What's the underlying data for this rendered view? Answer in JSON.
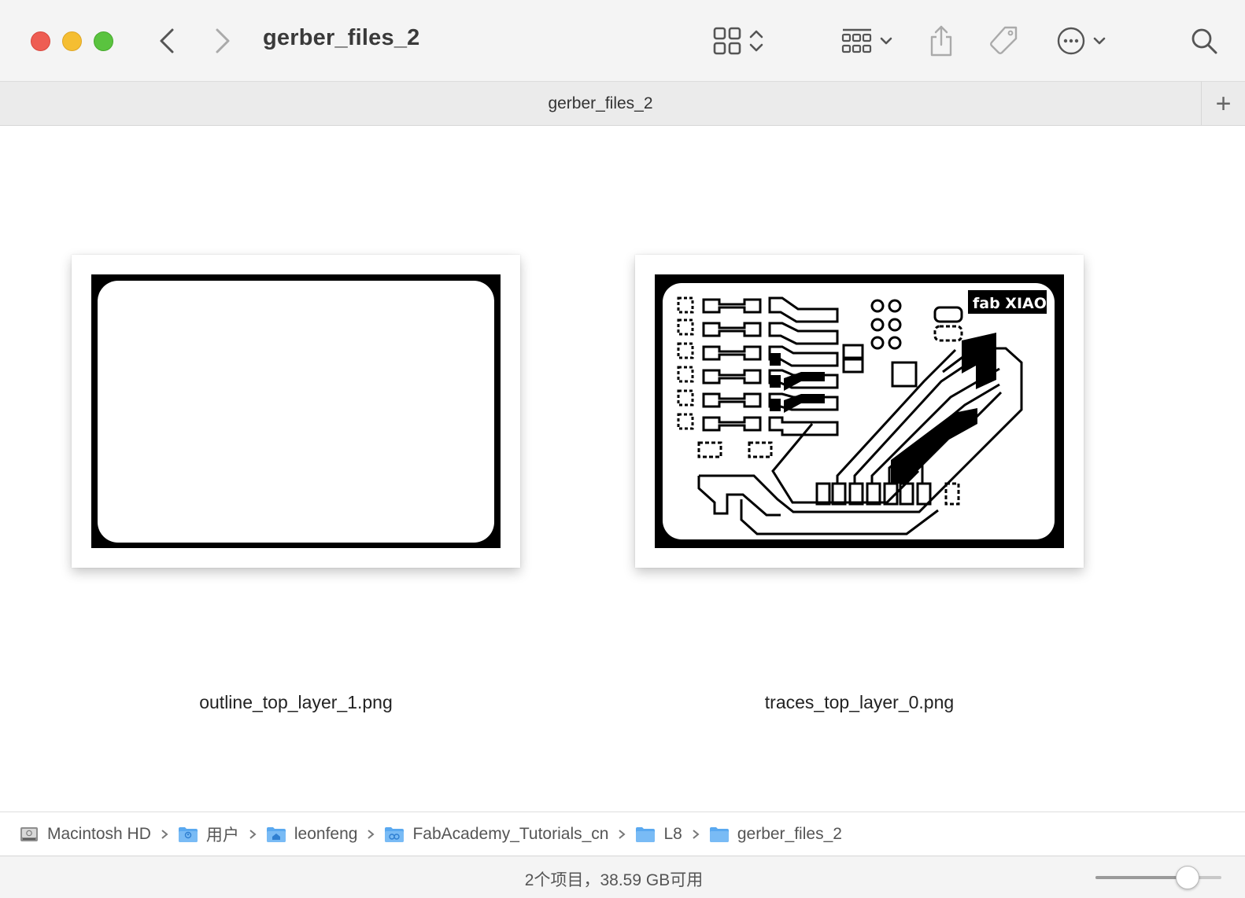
{
  "window": {
    "title": "gerber_files_2"
  },
  "toolbar": {
    "back_icon": "chevron-left-icon",
    "forward_icon": "chevron-right-icon",
    "view_icon": "grid-view-icon",
    "group_icon": "group-by-icon",
    "share_icon": "share-icon",
    "tag_icon": "tag-icon",
    "more_icon": "ellipsis-circle-icon",
    "search_icon": "search-icon"
  },
  "tabbar": {
    "tab_title": "gerber_files_2",
    "add_label": "+"
  },
  "files": [
    {
      "name": "outline_top_layer_1.png"
    },
    {
      "name": "traces_top_layer_0.png",
      "board_text": "fab XIAO"
    }
  ],
  "pathbar": {
    "crumbs": [
      {
        "label": "Macintosh HD",
        "icon": "hard-drive-icon"
      },
      {
        "label": "用户",
        "icon": "users-folder-icon"
      },
      {
        "label": "leonfeng",
        "icon": "home-folder-icon"
      },
      {
        "label": "FabAcademy_Tutorials_cn",
        "icon": "shared-folder-icon"
      },
      {
        "label": "L8",
        "icon": "folder-icon"
      },
      {
        "label": "gerber_files_2",
        "icon": "folder-icon"
      }
    ]
  },
  "statusbar": {
    "text": "2个项目，38.59 GB可用",
    "zoom_fraction": 0.73
  },
  "colors": {
    "close": "#ee5d53",
    "minimize": "#f5be32",
    "maximize": "#5ac33f",
    "folder_blue": "#5aa9f0"
  }
}
